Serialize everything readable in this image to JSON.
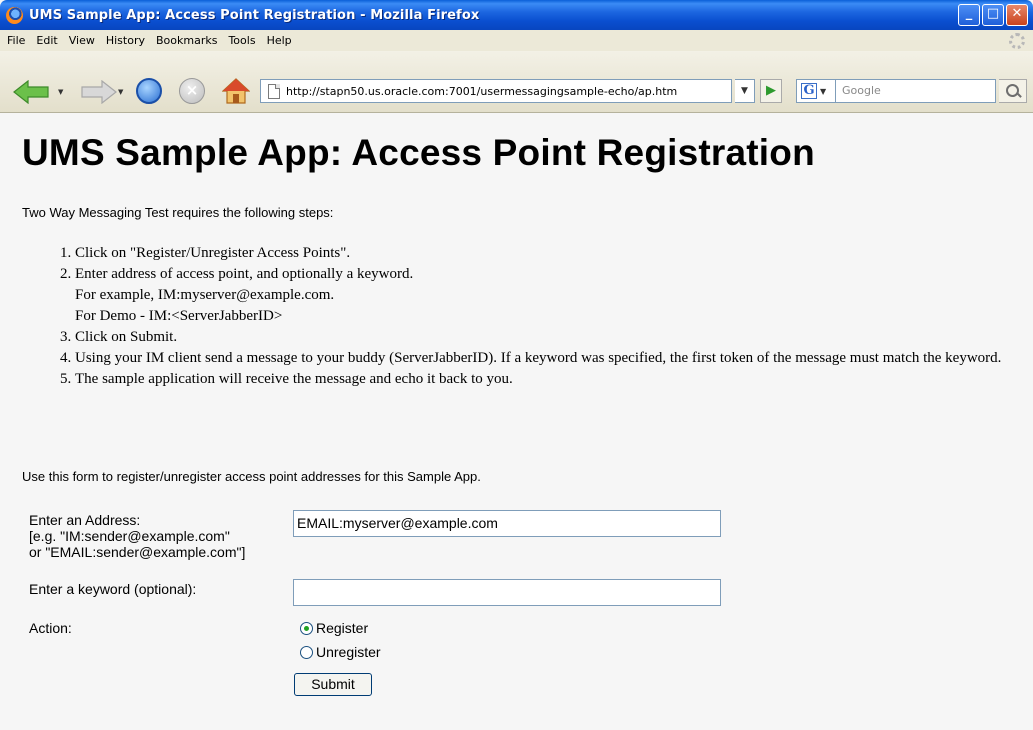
{
  "window": {
    "title": "UMS Sample App: Access Point Registration - Mozilla Firefox",
    "buttons": {
      "minimize": "_",
      "maximize": "□",
      "close": "✕"
    }
  },
  "menu": [
    "File",
    "Edit",
    "View",
    "History",
    "Bookmarks",
    "Tools",
    "Help"
  ],
  "nav": {
    "url": "http://stapn50.us.oracle.com:7001/usermessagingsample-echo/ap.htm",
    "search_engine": "G",
    "search_placeholder": "Google"
  },
  "page": {
    "title": "UMS Sample App: Access Point Registration",
    "intro": "Two Way Messaging Test requires the following steps:",
    "steps": [
      "Click on \"Register/Unregister Access Points\".",
      "Enter address of access point, and optionally a keyword.",
      "For example, IM:myserver@example.com.",
      "For Demo - IM:<ServerJabberID>",
      "Click on Submit.",
      "Using your IM client send a message to your buddy (ServerJabberID). If a keyword was specified, the first token of the message must match the keyword.",
      "The sample application will receive the message and echo it back to you."
    ],
    "usage": "Use this form to register/unregister access point addresses for this Sample App.",
    "form": {
      "address_label": "Enter an Address:",
      "address_hint_1": "[e.g. \"IM:sender@example.com\"",
      "address_hint_2": "or \"EMAIL:sender@example.com\"]",
      "address_value": "EMAIL:myserver@example.com",
      "keyword_label": "Enter a keyword (optional):",
      "keyword_value": "",
      "action_label": "Action:",
      "register_label": "Register",
      "unregister_label": "Unregister",
      "register_checked": true,
      "submit_label": "Submit"
    }
  }
}
